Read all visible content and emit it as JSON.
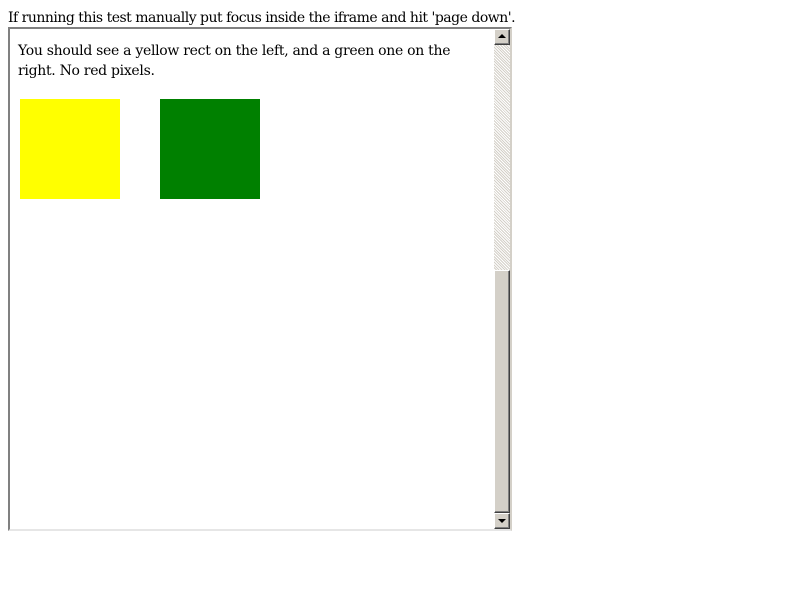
{
  "instructions": "If running this test manually put focus inside the iframe and hit 'page down'.",
  "iframe": {
    "text": "You should see a yellow rect on the left, and a green one on the right. No red pixels.",
    "rects": {
      "left_color": "#ffff00",
      "right_color": "#008000"
    },
    "scrollbar": {
      "position_fraction": 0.48,
      "visible_fraction": 0.52,
      "up_icon": "triangle-up",
      "down_icon": "triangle-down"
    }
  }
}
